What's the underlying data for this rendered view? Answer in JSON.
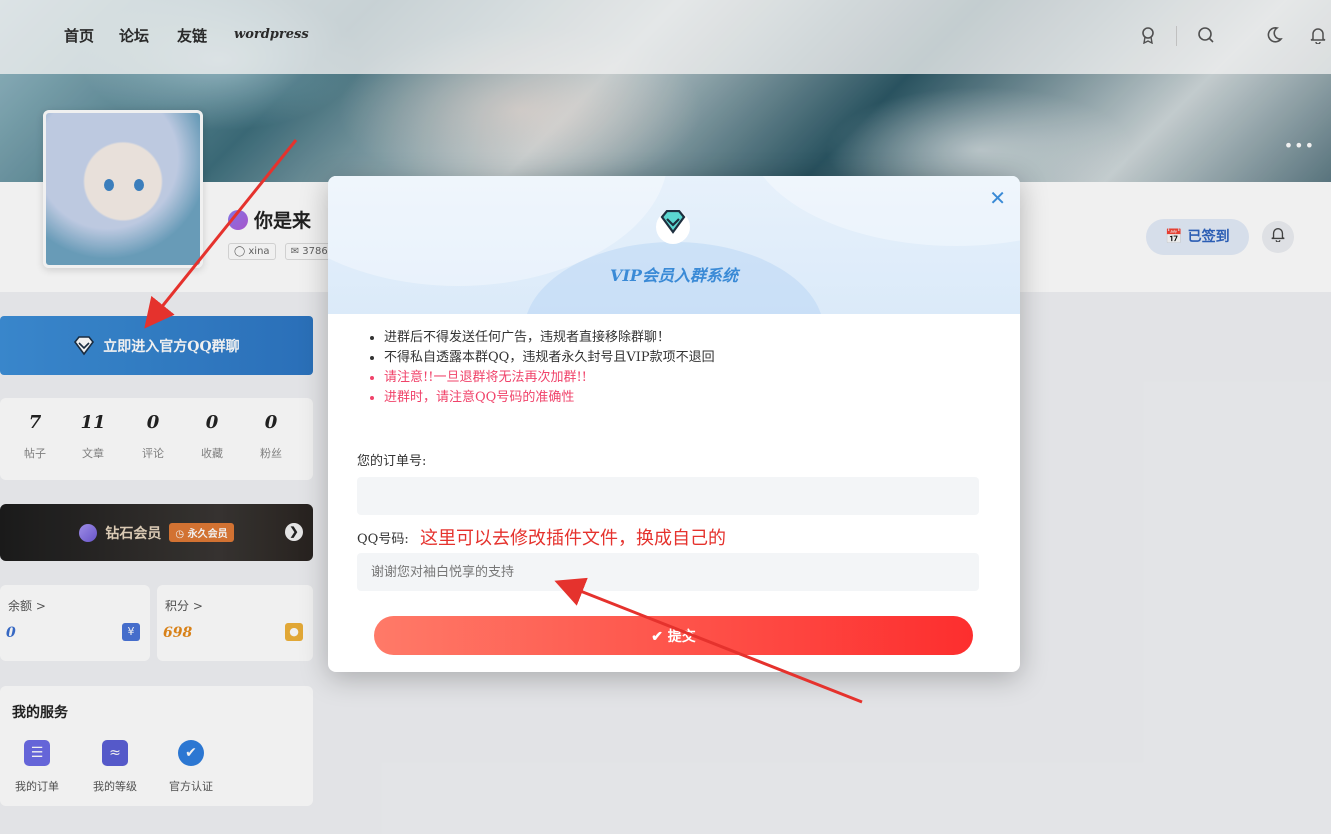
{
  "nav": {
    "links": [
      "首页",
      "论坛",
      "友链",
      "wordpress"
    ],
    "icons": [
      "award-icon",
      "search-icon",
      "moon-icon",
      "bell-icon"
    ]
  },
  "profile": {
    "username": "你是来",
    "tag_user": "xina",
    "tag_mail": "3786",
    "checkin_label": "已签到"
  },
  "sidebar": {
    "join_button": "立即进入官方QQ群聊",
    "stats": [
      {
        "value": "7",
        "label": "帖子"
      },
      {
        "value": "11",
        "label": "文章"
      },
      {
        "value": "0",
        "label": "评论"
      },
      {
        "value": "0",
        "label": "收藏"
      },
      {
        "value": "0",
        "label": "粉丝"
      }
    ],
    "vip": {
      "label": "钻石会员",
      "badge": "永久会员"
    },
    "balance": {
      "label": "余额 >",
      "value": "0"
    },
    "points": {
      "label": "积分 >",
      "value": "698"
    },
    "services": {
      "title": "我的服务",
      "items": [
        "我的订单",
        "我的等级",
        "官方认证"
      ]
    }
  },
  "modal": {
    "title": "VIP会员入群系统",
    "rules": [
      {
        "text": "进群后不得发送任何广告，违规者直接移除群聊！",
        "red": false
      },
      {
        "text": "不得私自透露本群QQ，违规者永久封号且VIP款项不退回",
        "red": false
      },
      {
        "text": "请注意!!一旦退群将无法再次加群!!",
        "red": true
      },
      {
        "text": "进群时，请注意QQ号码的准确性",
        "red": true
      }
    ],
    "order_label": "您的订单号:",
    "order_value": "",
    "qq_label": "QQ号码:",
    "qq_placeholder": "谢谢您对袖白悦享的支持",
    "annotation": "这里可以去修改插件文件，换成自己的",
    "submit_label": "✔ 提交"
  },
  "colors": {
    "accent": "#3a8ad6",
    "danger": "#f0436a",
    "submit_start": "#ff7a68",
    "submit_end": "#fd2e2e",
    "annotation": "#e5322d"
  }
}
